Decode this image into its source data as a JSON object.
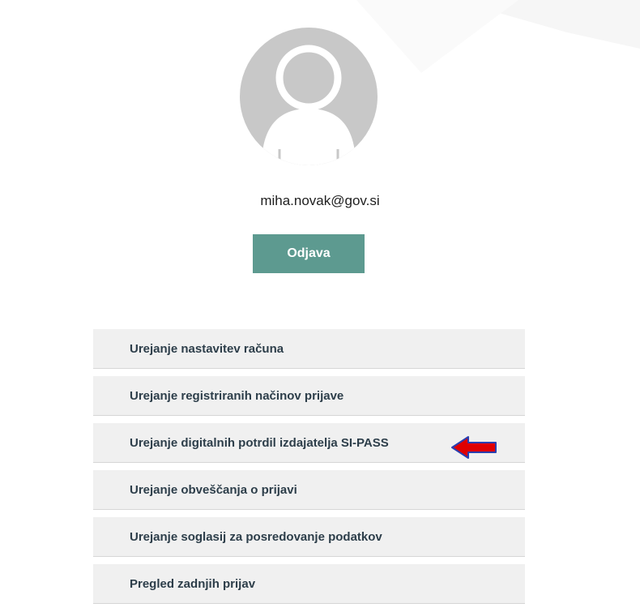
{
  "user": {
    "email": "miha.novak@gov.si",
    "logout_label": "Odjava"
  },
  "menu": {
    "items": [
      {
        "label": "Urejanje nastavitev računa"
      },
      {
        "label": "Urejanje registriranih načinov prijave"
      },
      {
        "label": "Urejanje digitalnih potrdil izdajatelja SI-PASS"
      },
      {
        "label": "Urejanje obveščanja o prijavi"
      },
      {
        "label": "Urejanje soglasij za posredovanje podatkov"
      },
      {
        "label": "Pregled zadnjih prijav"
      }
    ]
  },
  "colors": {
    "accent": "#5d9a90",
    "menu_bg": "#f0f0f0",
    "menu_text": "#2d3e4a",
    "annotation_arrow": "#e00000"
  },
  "icons": {
    "avatar": "user-avatar-icon",
    "annotation": "left-arrow-icon"
  }
}
